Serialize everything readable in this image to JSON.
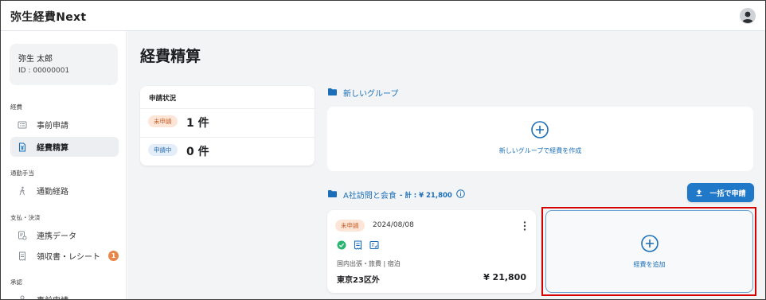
{
  "app": {
    "brand": "弥生経費Next"
  },
  "sidebar": {
    "user": {
      "name": "弥生 太郎",
      "id": "ID : 00000001"
    },
    "sections": {
      "expenses": "経費",
      "commute": "通勤手当",
      "payment": "支払・決済",
      "approval": "承認"
    },
    "items": {
      "pre_application": "事前申請",
      "expense_settlement": "経費精算",
      "commute_route": "通勤経路",
      "linked_data": "連携データ",
      "receipts": "領収書・レシート",
      "receipts_badge": "1",
      "approval_pre_application": "事前申請"
    }
  },
  "main": {
    "title": "経費精算",
    "status": {
      "title": "申請状況",
      "unapplied_label": "未申請",
      "unapplied_count": "1 件",
      "applying_label": "申請中",
      "applying_count": "0 件"
    },
    "new_group": {
      "heading": "新しいグループ",
      "create_text": "新しいグループで経費を作成"
    },
    "group_a": {
      "heading": "A社訪問と会食",
      "total": "- 計 : ¥ 21,800",
      "bulk_apply": "一括で申請"
    },
    "expense": {
      "status": "未申請",
      "date": "2024/08/08",
      "category": "国内出張・旅費 | 宿泊",
      "place": "東京23区外",
      "amount": "¥ 21,800"
    },
    "add_expense": "経費を追加"
  },
  "colors": {
    "accent": "#1f78c8",
    "highlight": "#d40000",
    "badge": "#e8864a",
    "check": "#2bb573"
  }
}
